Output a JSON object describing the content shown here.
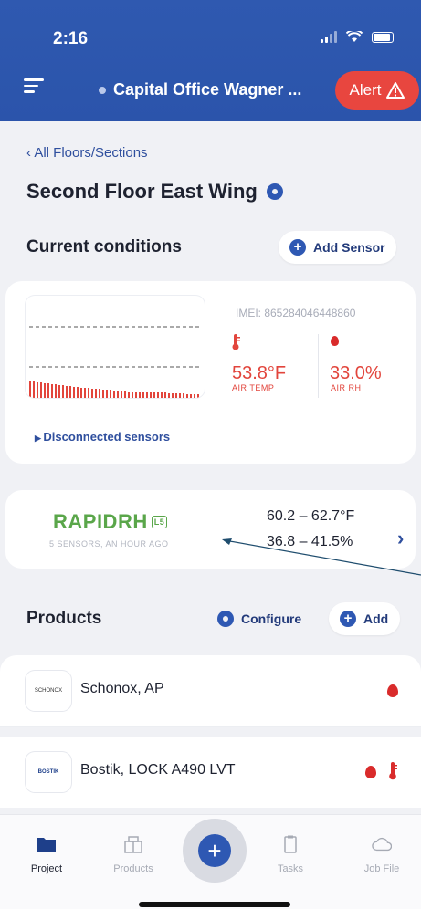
{
  "status": {
    "time": "2:16"
  },
  "header": {
    "project_title": "Capital Office Wagner ...",
    "alert_label": "Alert"
  },
  "breadcrumb": "All Floors/Sections",
  "page_title": "Second Floor East Wing",
  "conditions": {
    "title": "Current conditions",
    "add_sensor_label": "Add Sensor",
    "sensor": {
      "imei": "IMEI: 865284046448860",
      "air_temp": "53.8°F",
      "air_temp_label": "AIR TEMP",
      "air_rh": "33.0%",
      "air_rh_label": "AIR RH"
    },
    "disconnected_label": "Disconnected sensors"
  },
  "rapidrh": {
    "logo_text": "RAPIDRH",
    "badge": "L5",
    "subtitle": "5 SENSORS, AN HOUR AGO",
    "temp_range": "60.2 – 62.7°F",
    "rh_range": "36.8 – 41.5%"
  },
  "products": {
    "title": "Products",
    "configure_label": "Configure",
    "add_label": "Add",
    "items": [
      {
        "name": "Schonox, AP",
        "logo": "SCHONOX"
      },
      {
        "name": "Bostik, LOCK A490 LVT",
        "logo": "BOSTIK"
      }
    ]
  },
  "nav": {
    "items": [
      {
        "label": "Project"
      },
      {
        "label": "Products"
      },
      {
        "label": "Tasks"
      },
      {
        "label": "Job File"
      }
    ]
  },
  "colors": {
    "brand": "#2e58b3",
    "alert": "#e8463f",
    "reading": "#e2453c",
    "rapid_green": "#5aa64a"
  }
}
